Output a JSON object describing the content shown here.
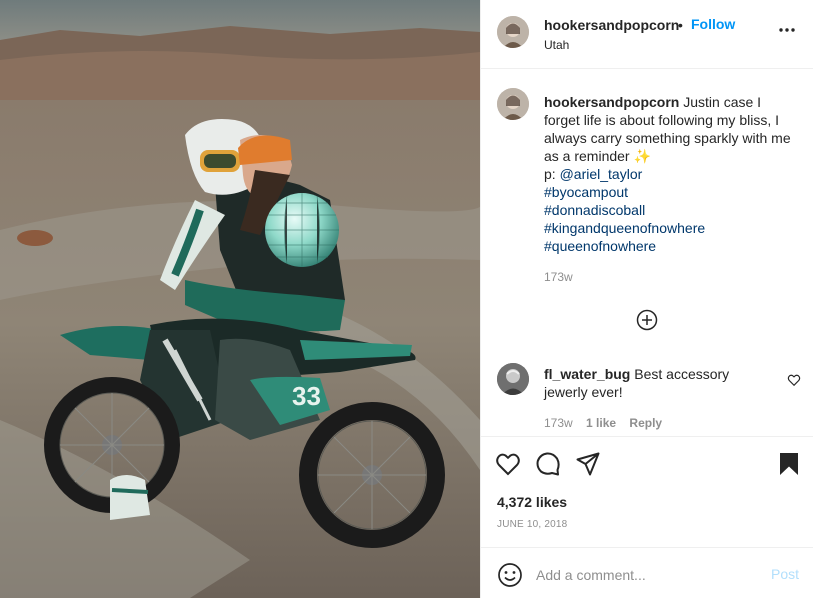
{
  "post": {
    "username": "hookersandpopcorn",
    "dot": "•",
    "follow_label": "Follow",
    "location": "Utah",
    "caption": {
      "username": "hookersandpopcorn",
      "text": " Justin case I forget life is about following my bliss, I always carry something sparkly with me as a reminder ✨",
      "credit_prefix": "p: ",
      "credit_handle": "@ariel_taylor",
      "hashtags": [
        "#byocampout",
        "#donnadiscoball",
        "#kingandqueenofnowhere",
        "#queenofnowhere"
      ],
      "time": "173w"
    },
    "comments": [
      {
        "username": "fl_water_bug",
        "text": " Best accessory jewerly ever!",
        "time": "173w",
        "likes": "1 like",
        "reply": "Reply"
      }
    ],
    "likes": "4,372 likes",
    "date": "JUNE 10, 2018",
    "add_comment": {
      "placeholder": "Add a comment...",
      "post_label": "Post"
    }
  },
  "icons": {
    "more": "more-options-icon",
    "load_more": "plus-circle-icon",
    "comment_like": "heart-icon",
    "like": "heart-icon",
    "comment": "comment-icon",
    "share": "share-icon",
    "save": "bookmark-icon",
    "emoji": "emoji-icon"
  },
  "colors": {
    "accent": "#0095f6",
    "link": "#00376b",
    "muted": "#8e8e8e",
    "post_disabled": "#b2dffc"
  }
}
